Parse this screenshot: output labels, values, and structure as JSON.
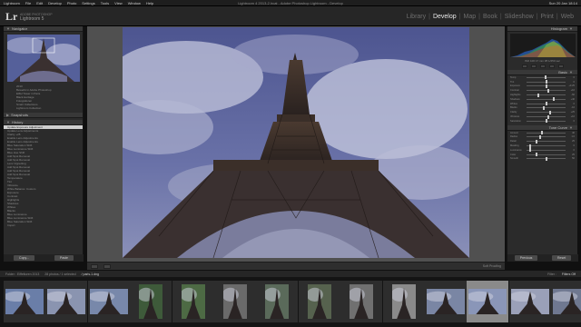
{
  "menubar": {
    "items": [
      "Lightroom",
      "File",
      "Edit",
      "Develop",
      "Photo",
      "Settings",
      "Tools",
      "View",
      "Window",
      "Help"
    ],
    "window_title": "Lightroom 4 2013-2.lrcat - Adobe Photoshop Lightroom - Develop",
    "clock": "Sun 20 Jan 18:14"
  },
  "identity": {
    "logo": "Lr",
    "sub1": "ADOBE PHOTOSHOP",
    "sub2": "Lightroom 5"
  },
  "modules": {
    "items": [
      "Library",
      "Develop",
      "Map",
      "Book",
      "Slideshow",
      "Print",
      "Web"
    ],
    "active": "Develop"
  },
  "left_panel": {
    "navigator_title": "Navigator",
    "collection_rows": [
      "2013",
      "Bewerkt in Adobe Photoshop",
      "Eiffel Tower in Paris",
      "Black Heritage",
      "Fotograferen",
      "Smart Collections",
      "Lightroom Collection"
    ],
    "snapshots_title": "Snapshots",
    "history_title": "History",
    "history_items": [
      "Update Exposure Adjustment",
      "Update Lens Adjustments",
      "Clarity +25",
      "Enable Lens Adjustments",
      "Enable Lens Adjustments",
      "Blue Saturation Shift",
      "Blue Luminance Shift",
      "Blue Hue Shift",
      "Add Spot Removal",
      "Add Spot Removal",
      "Lens Vignetting",
      "Add Spot Removal",
      "Add Spot Removal",
      "Add Spot Removal",
      "Temperature",
      "Tint",
      "Vibrance",
      "White Balance: Custom",
      "Exposure",
      "Contrast",
      "Highlights",
      "Shadows",
      "Whites",
      "Blacks",
      "Blue Luminance",
      "Blue Luminance Shift",
      "Blue Saturation Shift",
      "Import"
    ],
    "copy_label": "Copy...",
    "paste_label": "Paste"
  },
  "toolbar": {
    "soft_proofing": "Soft Proofing"
  },
  "right_panel": {
    "histogram_title": "Histogram",
    "photo_info": "ISO 100  17 mm  f/8  1/250 sec",
    "basic_title": "Basic",
    "sliders": [
      {
        "label": "Temp",
        "value": 0.48,
        "display": "0"
      },
      {
        "label": "Tint",
        "value": 0.5,
        "display": "0"
      },
      {
        "label": "Exposure",
        "value": 0.52,
        "display": "+0.25"
      },
      {
        "label": "Contrast",
        "value": 0.55,
        "display": "+10"
      },
      {
        "label": "Highlights",
        "value": 0.3,
        "display": "-60"
      },
      {
        "label": "Shadows",
        "value": 0.7,
        "display": "+40"
      },
      {
        "label": "Whites",
        "value": 0.5,
        "display": "0"
      },
      {
        "label": "Blacks",
        "value": 0.45,
        "display": "-10"
      },
      {
        "label": "Clarity",
        "value": 0.6,
        "display": "+25"
      },
      {
        "label": "Vibrance",
        "value": 0.55,
        "display": "+10"
      },
      {
        "label": "Saturation",
        "value": 0.5,
        "display": "0"
      }
    ],
    "tone_curve_title": "Tone Curve",
    "detail_sliders": [
      {
        "label": "Amount",
        "value": 0.4,
        "display": "40"
      },
      {
        "label": "Radius",
        "value": 0.35,
        "display": "1.0"
      },
      {
        "label": "Detail",
        "value": 0.25,
        "display": "25"
      },
      {
        "label": "Masking",
        "value": 0.1,
        "display": "0"
      },
      {
        "label": "Luminance",
        "value": 0.1,
        "display": "0"
      },
      {
        "label": "Color",
        "value": 0.25,
        "display": "25"
      },
      {
        "label": "Smooth",
        "value": 0.5,
        "display": "50"
      }
    ],
    "previous_label": "Previous",
    "reset_label": "Reset"
  },
  "filmstrip_bar": {
    "path_prefix": "Folder : Eiffeltoren 2013",
    "path_count": "28 photos / 1 selected",
    "path_file": "/ paris-1.dng",
    "filter_label": "Filter :",
    "filter_value": "Filters Off"
  },
  "colors": {
    "sky": "#5a6396",
    "accent_active": "#8a8a8a"
  }
}
